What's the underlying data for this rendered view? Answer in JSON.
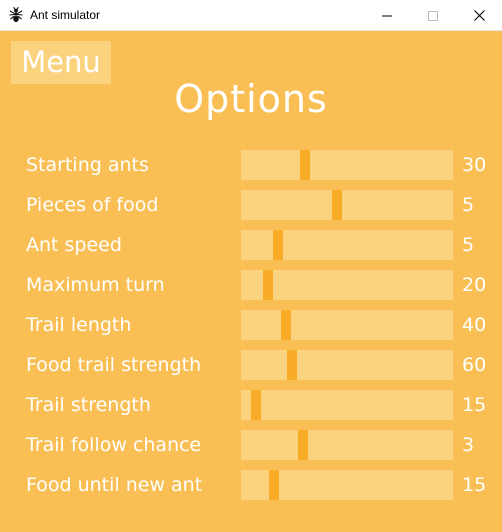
{
  "window": {
    "title": "Ant simulator",
    "icon": "ant-icon",
    "controls": {
      "minimize": "minimize-icon",
      "maximize": "maximize-icon",
      "close": "close-icon"
    }
  },
  "menu": {
    "label": "Menu"
  },
  "page": {
    "title": "Options"
  },
  "colors": {
    "background": "#f9bf55",
    "track": "#fbd27e",
    "thumb": "#f8ac28",
    "text": "#ffffff"
  },
  "options": [
    {
      "label": "Starting ants",
      "value": "30",
      "level": 0.29
    },
    {
      "label": "Pieces of food",
      "value": "5",
      "level": 0.45
    },
    {
      "label": "Ant speed",
      "value": "5",
      "level": 0.16
    },
    {
      "label": "Maximum turn",
      "value": "20",
      "level": 0.11
    },
    {
      "label": "Trail length",
      "value": "40",
      "level": 0.2
    },
    {
      "label": "Food trail strength",
      "value": "60",
      "level": 0.23
    },
    {
      "label": "Trail strength",
      "value": "15",
      "level": 0.05
    },
    {
      "label": "Trail follow chance",
      "value": "3",
      "level": 0.28
    },
    {
      "label": "Food until new ant",
      "value": "15",
      "level": 0.14
    }
  ]
}
